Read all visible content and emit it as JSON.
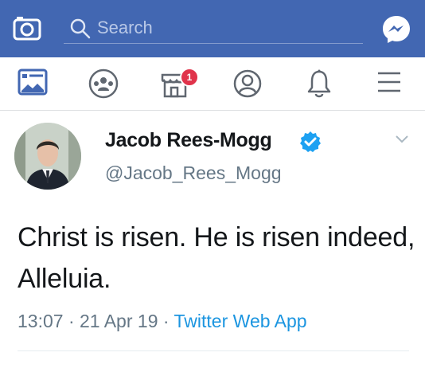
{
  "header": {
    "search_placeholder": "Search",
    "brand_color": "#4267b2",
    "icons": [
      "camera-icon",
      "search-icon",
      "messenger-icon"
    ]
  },
  "nav": {
    "icons": [
      "news-feed-icon",
      "groups-icon",
      "marketplace-icon",
      "profile-icon",
      "notifications-icon",
      "menu-icon"
    ],
    "marketplace_badge": "1"
  },
  "tweet": {
    "name": "Jacob Rees-Mogg",
    "handle": "@Jacob_Rees_Mogg",
    "text": "Christ is risen. He is risen indeed, Alleluia.",
    "time": "13:07",
    "separator1": "·",
    "date": "21 Apr 19",
    "separator2": "·",
    "source": "Twitter Web App",
    "verified_color": "#1da1f2",
    "source_color": "#1b95e0"
  }
}
